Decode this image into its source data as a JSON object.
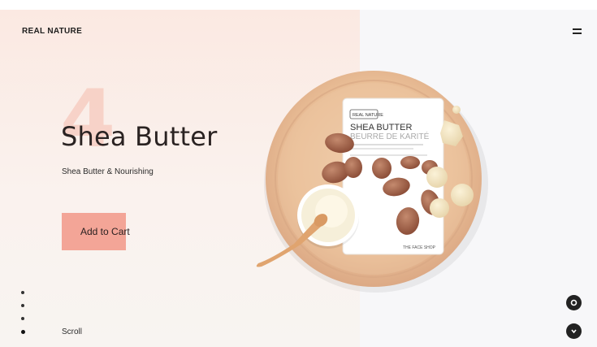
{
  "brand": "REAL NATURE",
  "product": {
    "index": "4",
    "title": "Shea Butter",
    "subtitle": "Shea Butter & Nourishing"
  },
  "cart_button": "Add to Cart",
  "scroll_label": "Scroll",
  "pager": {
    "count": 4,
    "active": 4
  },
  "package": {
    "brand_tag": "REAL NATURE",
    "name": "SHEA BUTTER",
    "name_fr": "BEURRE DE KARITÉ",
    "maker": "THE FACE SHOP"
  },
  "icons": {
    "menu": "hamburger-icon",
    "circle_one": "circle-icon",
    "circle_two": "chevron-down-icon"
  },
  "colors": {
    "accent": "#f3a597",
    "left_bg": "#fbe9e2",
    "right_bg": "#f7f7f9",
    "wood": "#ecc19e"
  }
}
